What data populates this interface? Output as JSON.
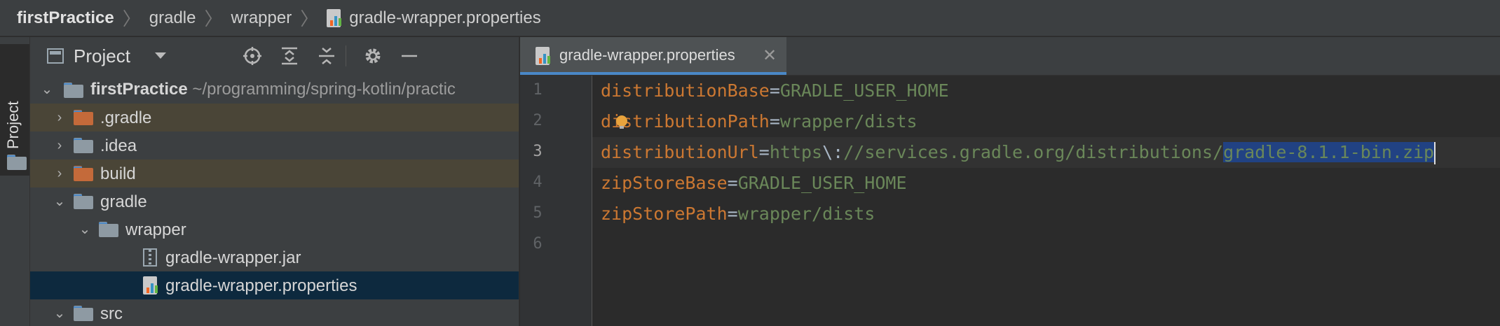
{
  "breadcrumb": {
    "items": [
      "firstPractice",
      "gradle",
      "wrapper",
      "gradle-wrapper.properties"
    ],
    "separator": "〉"
  },
  "left_strip": {
    "label": "Project"
  },
  "project_panel": {
    "title": "Project",
    "tools": [
      "locate-icon",
      "expand-all-icon",
      "collapse-all-icon",
      "gear-icon",
      "minimize-icon"
    ],
    "tree": [
      {
        "label": "firstPractice",
        "path": "~/programming/spring-kotlin/practic",
        "expanded": true,
        "icon": "module-folder-icon"
      },
      {
        "label": ".gradle",
        "expanded": false,
        "icon": "excluded-folder-icon"
      },
      {
        "label": ".idea",
        "expanded": false,
        "icon": "folder-icon"
      },
      {
        "label": "build",
        "expanded": false,
        "icon": "excluded-folder-icon"
      },
      {
        "label": "gradle",
        "expanded": true,
        "icon": "folder-icon"
      },
      {
        "label": "wrapper",
        "expanded": true,
        "icon": "folder-icon"
      },
      {
        "label": "gradle-wrapper.jar",
        "icon": "jar-file-icon"
      },
      {
        "label": "gradle-wrapper.properties",
        "icon": "properties-file-icon",
        "selected": true
      },
      {
        "label": "src",
        "expanded": true,
        "icon": "folder-icon"
      }
    ]
  },
  "editor": {
    "tab": {
      "label": "gradle-wrapper.properties",
      "close": "✕"
    },
    "line_numbers": [
      "1",
      "2",
      "3",
      "4",
      "5",
      "6"
    ],
    "current_line": 3,
    "lines": [
      {
        "key": "distributionBase",
        "eq": "=",
        "value": "GRADLE_USER_HOME"
      },
      {
        "key_prefix": "d",
        "key_rest": "istributionPath",
        "eq": "=",
        "value": "wrapper/dists"
      },
      {
        "key": "distributionUrl",
        "eq": "=",
        "value_a": "https",
        "esc": "\\:",
        "value_b": "//services.gradle.org/distributions/",
        "selected": "gradle-8.1.1-bin.zip"
      },
      {
        "key": "zipStoreBase",
        "eq": "=",
        "value": "GRADLE_USER_HOME"
      },
      {
        "key": "zipStorePath",
        "eq": "=",
        "value": "wrapper/dists"
      }
    ]
  },
  "colors": {
    "keyword_orange": "#cc7832",
    "string_green": "#6a8759",
    "selection": "#214283",
    "tree_selection": "#0d293e",
    "excluded_row": "#4a4537"
  }
}
